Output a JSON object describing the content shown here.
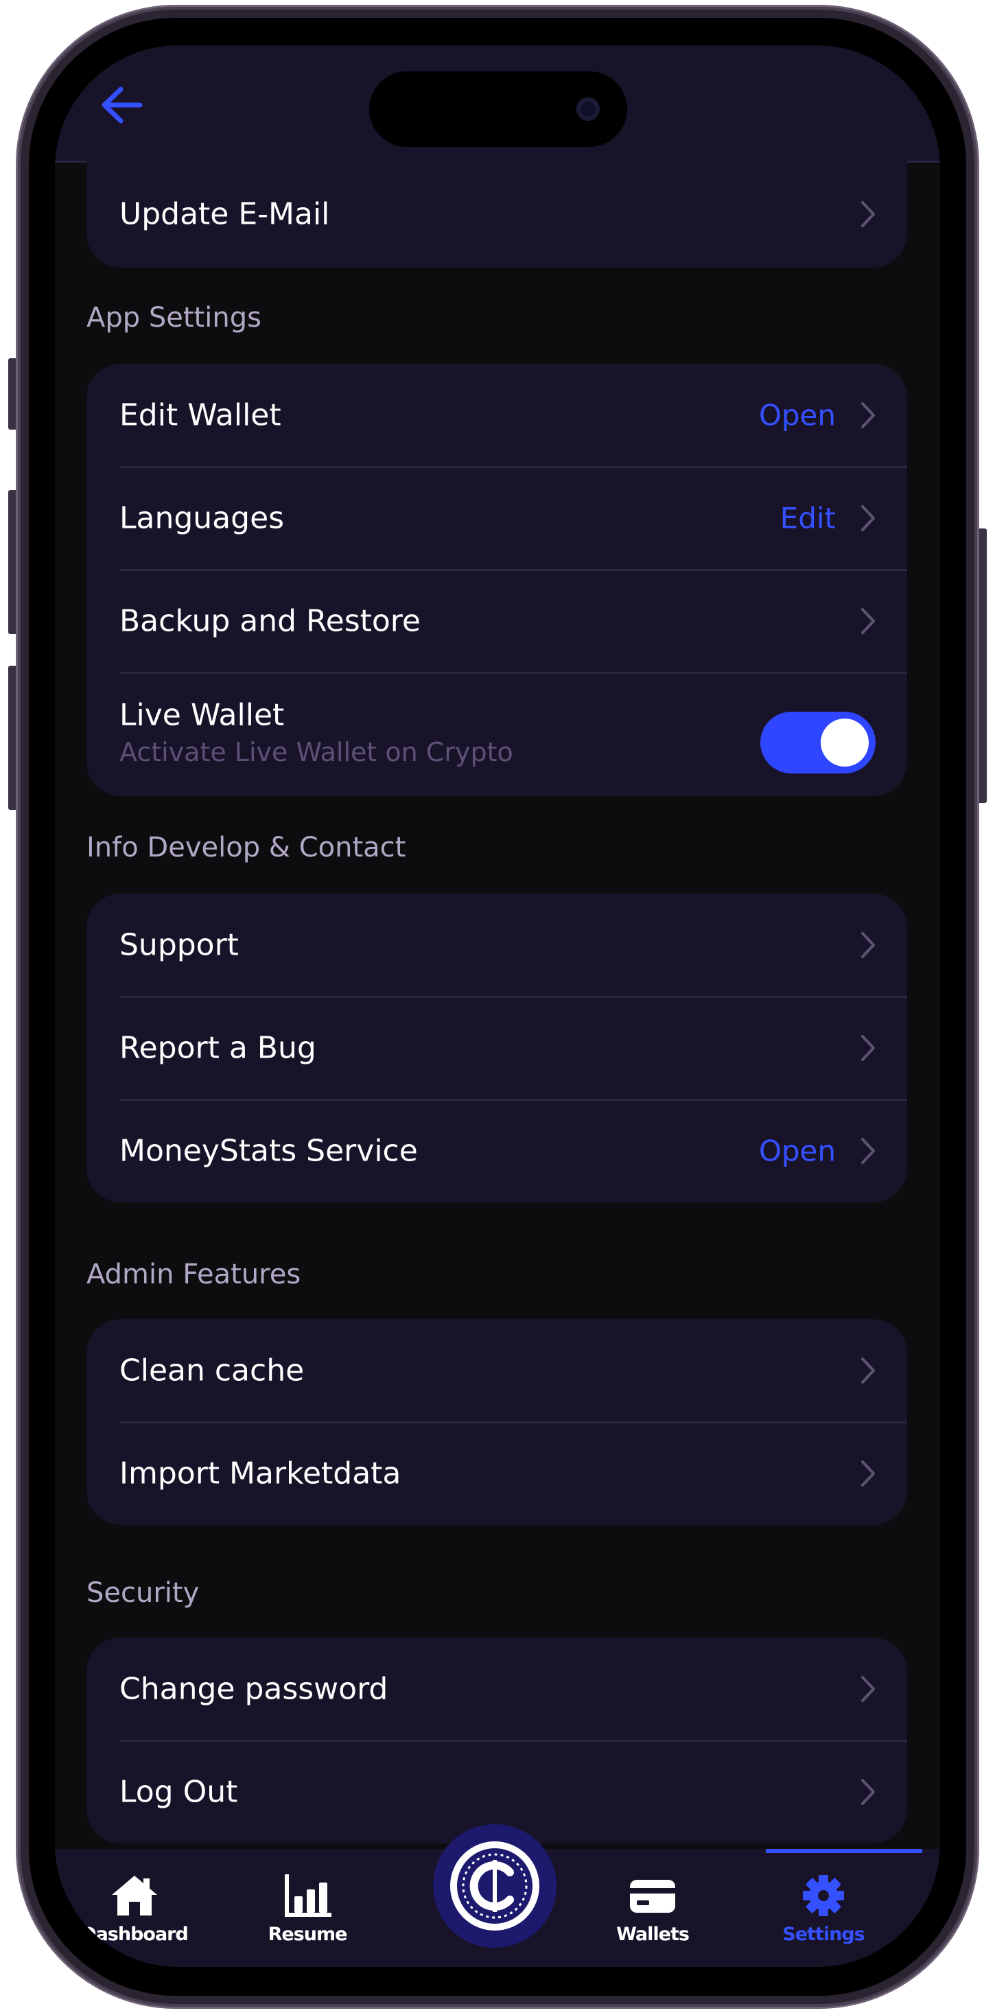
{
  "accent_color": "#3550ff",
  "header": {
    "back_icon": "arrow-left-icon"
  },
  "account": {
    "update_email": "Update E-Mail"
  },
  "app_settings": {
    "title": "App Settings",
    "edit_wallet": {
      "label": "Edit Wallet",
      "action": "Open"
    },
    "languages": {
      "label": "Languages",
      "action": "Edit"
    },
    "backup": {
      "label": "Backup and Restore"
    },
    "live_wallet": {
      "label": "Live Wallet",
      "subtitle": "Activate Live Wallet on Crypto",
      "enabled": true
    }
  },
  "info": {
    "title": "Info Develop & Contact",
    "support": {
      "label": "Support"
    },
    "report_bug": {
      "label": "Report a Bug"
    },
    "moneystats": {
      "label": "MoneyStats Service",
      "action": "Open"
    }
  },
  "admin": {
    "title": "Admin Features",
    "clean_cache": {
      "label": "Clean cache"
    },
    "import_marketdata": {
      "label": "Import Marketdata"
    }
  },
  "security": {
    "title": "Security",
    "change_password": {
      "label": "Change password"
    },
    "log_out": {
      "label": "Log Out"
    }
  },
  "tabbar": {
    "dashboard": {
      "label": "Dashboard",
      "icon": "home-icon"
    },
    "resume": {
      "label": "Resume",
      "icon": "bar-chart-icon"
    },
    "center": {
      "icon": "coin-logo-icon"
    },
    "wallets": {
      "label": "Wallets",
      "icon": "wallet-card-icon"
    },
    "settings": {
      "label": "Settings",
      "icon": "gear-icon",
      "active": true
    }
  }
}
